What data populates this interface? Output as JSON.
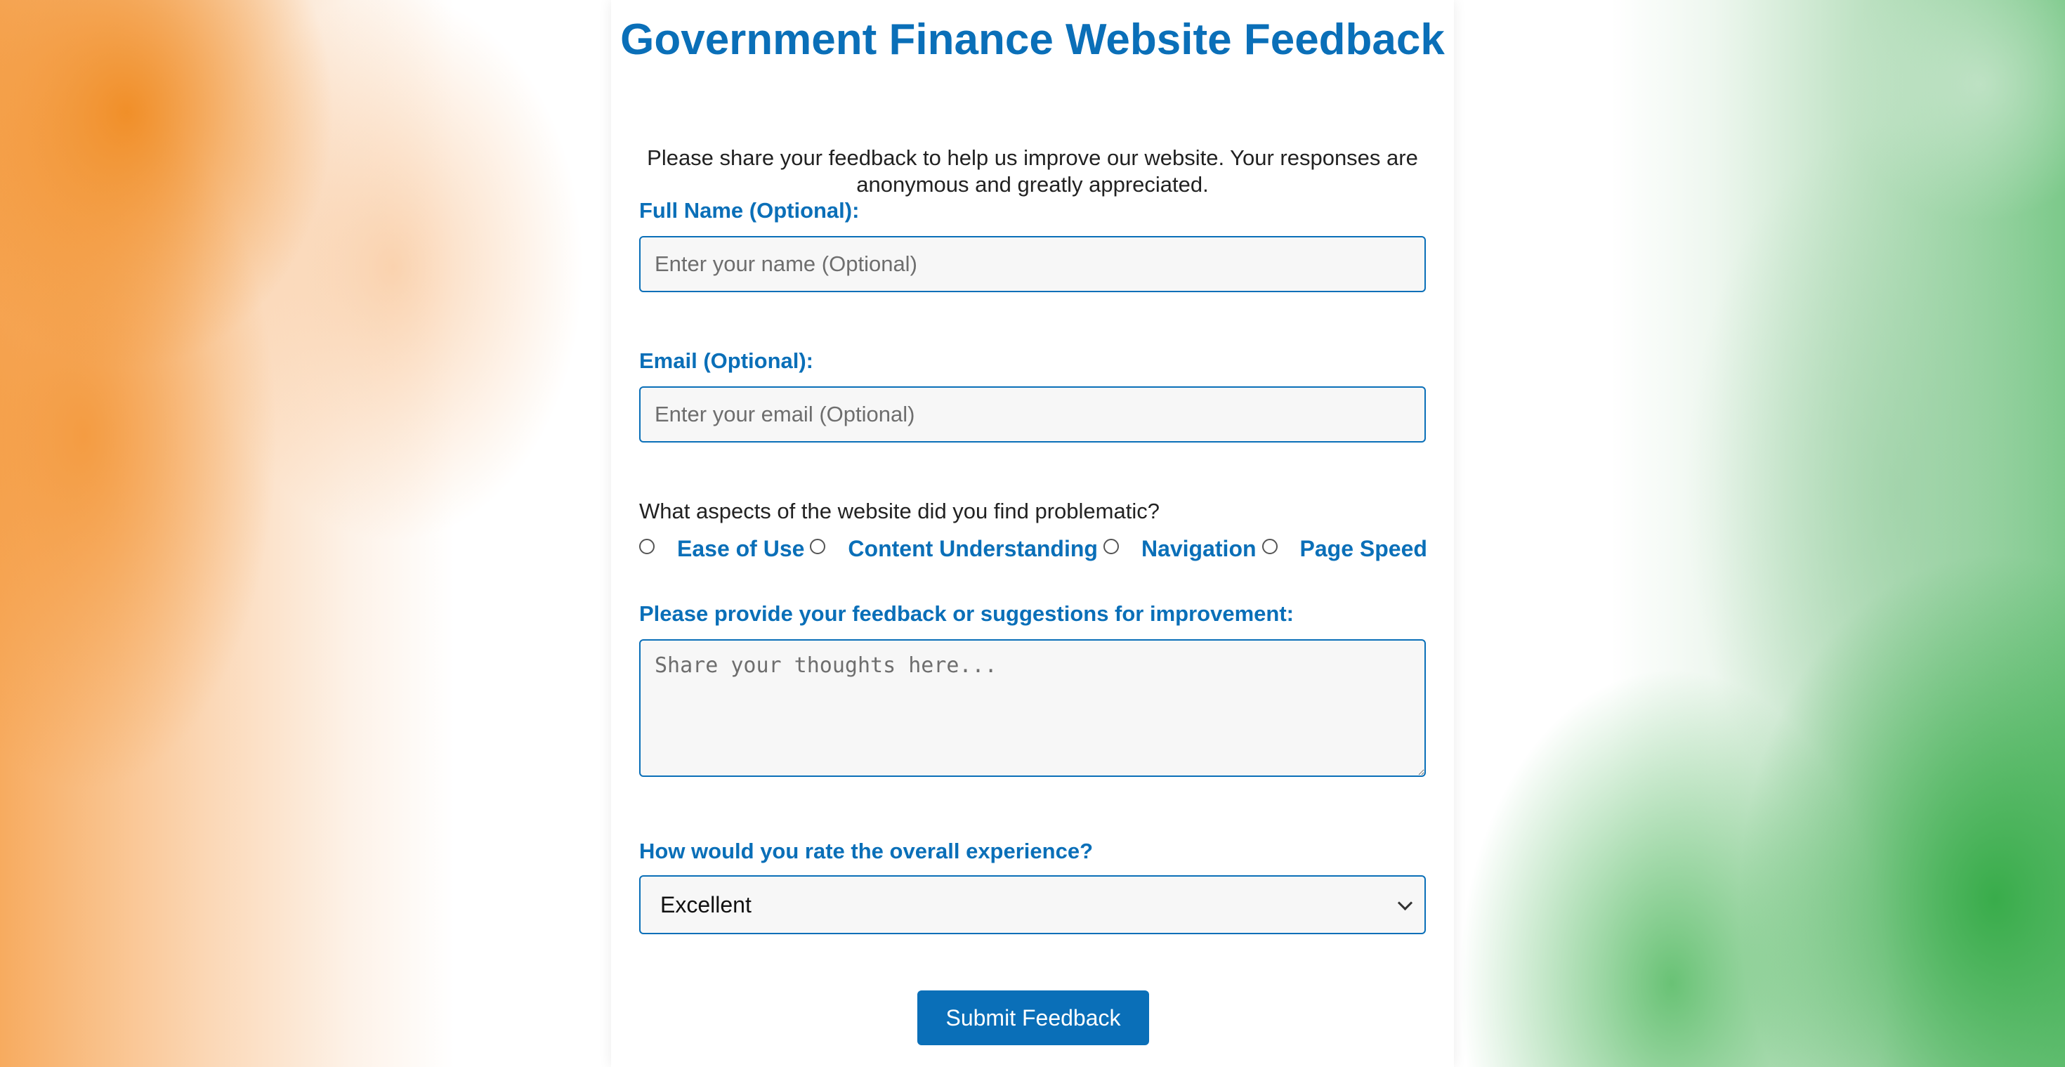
{
  "page": {
    "title": "Government Finance Website Feedback",
    "intro": "Please share your feedback to help us improve our website. Your responses are anonymous and greatly appreciated."
  },
  "form": {
    "name": {
      "label": "Full Name (Optional):",
      "placeholder": "Enter your name (Optional)",
      "value": ""
    },
    "email": {
      "label": "Email (Optional):",
      "placeholder": "Enter your email (Optional)",
      "value": ""
    },
    "aspects": {
      "question": "What aspects of the website did you find problematic?",
      "options": [
        {
          "label": "Ease of Use",
          "checked": false
        },
        {
          "label": "Content Understanding",
          "checked": false
        },
        {
          "label": "Navigation",
          "checked": false
        },
        {
          "label": "Page Speed",
          "checked": false
        }
      ]
    },
    "feedback": {
      "label": "Please provide your feedback or suggestions for improvement:",
      "placeholder": "Share your thoughts here...",
      "value": ""
    },
    "rating": {
      "label": "How would you rate the overall experience?",
      "selected": "Excellent"
    },
    "submit_label": "Submit Feedback"
  },
  "colors": {
    "accent": "#0a6fb8",
    "text": "#222222",
    "field_bg": "#f7f7f7",
    "saffron": "#f08c23",
    "green": "#34aa46"
  },
  "icons": {
    "select_arrow": "chevron-down-icon"
  }
}
